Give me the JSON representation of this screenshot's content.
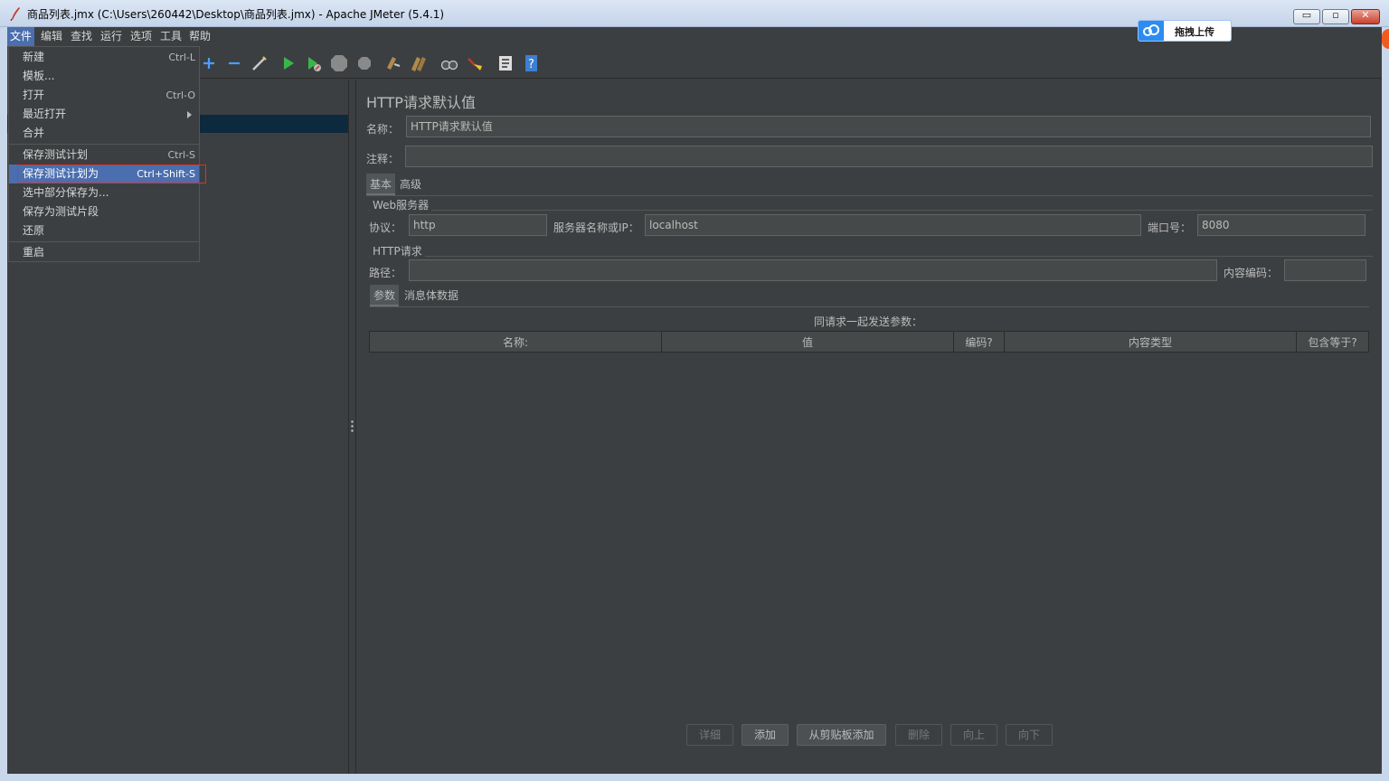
{
  "window": {
    "title": "商品列表.jmx (C:\\Users\\260442\\Desktop\\商品列表.jmx) - Apache JMeter (5.4.1)",
    "min_glyph": "▭",
    "max_glyph": "▫",
    "close_glyph": "✕"
  },
  "upload_badge": {
    "label": "拖拽上传"
  },
  "menubar": [
    {
      "label": "文件"
    },
    {
      "label": "编辑"
    },
    {
      "label": "查找"
    },
    {
      "label": "运行"
    },
    {
      "label": "选项"
    },
    {
      "label": "工具"
    },
    {
      "label": "帮助"
    }
  ],
  "file_menu": {
    "items": [
      {
        "label": "新建",
        "shortcut": "Ctrl-L"
      },
      {
        "label": "模板...",
        "shortcut": ""
      },
      {
        "label": "打开",
        "shortcut": "Ctrl-O"
      },
      {
        "label": "最近打开",
        "shortcut": ""
      },
      {
        "label": "合并",
        "shortcut": ""
      },
      {
        "label": "保存测试计划",
        "shortcut": "Ctrl-S"
      },
      {
        "label": "保存测试计划为",
        "shortcut": "Ctrl+Shift-S"
      },
      {
        "label": "选中部分保存为...",
        "shortcut": ""
      },
      {
        "label": "保存为测试片段",
        "shortcut": ""
      },
      {
        "label": "还原",
        "shortcut": ""
      },
      {
        "label": "重启",
        "shortcut": ""
      }
    ]
  },
  "panel": {
    "heading": "HTTP请求默认值",
    "name_label": "名称：",
    "name_value": "HTTP请求默认值",
    "comment_label": "注释：",
    "comment_value": "",
    "tabs": [
      {
        "label": "基本"
      },
      {
        "label": "高级"
      }
    ],
    "web_server": {
      "group_title": "Web服务器",
      "protocol_label": "协议：",
      "protocol_value": "http",
      "server_label": "服务器名称或IP：",
      "server_value": "localhost",
      "port_label": "端口号：",
      "port_value": "8080"
    },
    "http_request": {
      "group_title": "HTTP请求",
      "path_label": "路径：",
      "path_value": "",
      "encoding_label": "内容编码：",
      "encoding_value": ""
    },
    "sub_tabs": [
      {
        "label": "参数"
      },
      {
        "label": "消息体数据"
      }
    ],
    "params_caption": "同请求一起发送参数：",
    "columns": [
      "名称:",
      "值",
      "编码?",
      "内容类型",
      "包含等于?"
    ],
    "buttons": [
      {
        "label": "详细",
        "enabled": false
      },
      {
        "label": "添加",
        "enabled": true
      },
      {
        "label": "从剪贴板添加",
        "enabled": true
      },
      {
        "label": "删除",
        "enabled": false
      },
      {
        "label": "向上",
        "enabled": false
      },
      {
        "label": "向下",
        "enabled": false
      }
    ]
  }
}
